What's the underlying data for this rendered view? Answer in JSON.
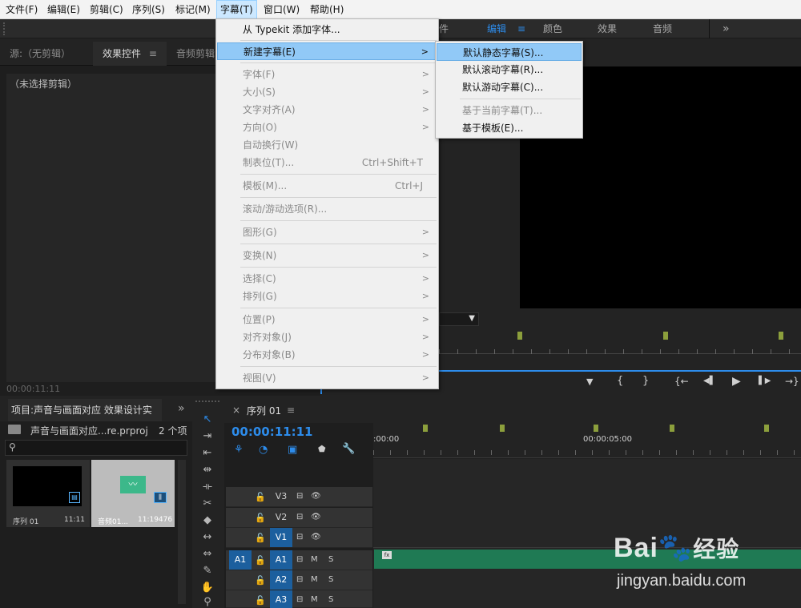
{
  "menubar": {
    "items": [
      "文件(F)",
      "编辑(E)",
      "剪辑(C)",
      "序列(S)",
      "标记(M)",
      "字幕(T)",
      "窗口(W)",
      "帮助(H)"
    ]
  },
  "workspace": {
    "partial": "件",
    "edit": "编辑",
    "menu_glyph": "≡",
    "color": "颜色",
    "effects": "效果",
    "audio": "音频",
    "more": "»"
  },
  "source_panel": {
    "tab_source": "源:（无剪辑）",
    "tab_effects": "效果控件",
    "tab_menu": "≡",
    "tab_audio": "音频剪辑",
    "empty_text": "（未选择剪辑）",
    "timecode": "00:00:11:11"
  },
  "title_menu": {
    "items": [
      {
        "label": "从 Typekit 添加字体...",
        "shortcut": "",
        "arrow": false,
        "disabled": false,
        "highlight": false
      },
      {
        "label": "新建字幕(E)",
        "shortcut": "",
        "arrow": true,
        "disabled": false,
        "highlight": true
      },
      {
        "label": "字体(F)",
        "shortcut": "",
        "arrow": true,
        "disabled": true,
        "highlight": false
      },
      {
        "label": "大小(S)",
        "shortcut": "",
        "arrow": true,
        "disabled": true,
        "highlight": false
      },
      {
        "label": "文字对齐(A)",
        "shortcut": "",
        "arrow": true,
        "disabled": true,
        "highlight": false
      },
      {
        "label": "方向(O)",
        "shortcut": "",
        "arrow": true,
        "disabled": true,
        "highlight": false
      },
      {
        "label": "自动换行(W)",
        "shortcut": "",
        "arrow": false,
        "disabled": true,
        "highlight": false
      },
      {
        "label": "制表位(T)...",
        "shortcut": "Ctrl+Shift+T",
        "arrow": false,
        "disabled": true,
        "highlight": false
      },
      {
        "label": "模板(M)...",
        "shortcut": "Ctrl+J",
        "arrow": false,
        "disabled": true,
        "highlight": false
      },
      {
        "label": "滚动/游动选项(R)...",
        "shortcut": "",
        "arrow": false,
        "disabled": true,
        "highlight": false
      },
      {
        "label": "图形(G)",
        "shortcut": "",
        "arrow": true,
        "disabled": true,
        "highlight": false
      },
      {
        "label": "变换(N)",
        "shortcut": "",
        "arrow": true,
        "disabled": true,
        "highlight": false
      },
      {
        "label": "选择(C)",
        "shortcut": "",
        "arrow": true,
        "disabled": true,
        "highlight": false
      },
      {
        "label": "排列(G)",
        "shortcut": "",
        "arrow": true,
        "disabled": true,
        "highlight": false
      },
      {
        "label": "位置(P)",
        "shortcut": "",
        "arrow": true,
        "disabled": true,
        "highlight": false
      },
      {
        "label": "对齐对象(J)",
        "shortcut": "",
        "arrow": true,
        "disabled": true,
        "highlight": false
      },
      {
        "label": "分布对象(B)",
        "shortcut": "",
        "arrow": true,
        "disabled": true,
        "highlight": false
      },
      {
        "label": "视图(V)",
        "shortcut": "",
        "arrow": true,
        "disabled": true,
        "highlight": false
      }
    ]
  },
  "submenu": {
    "items": [
      {
        "label": "默认静态字幕(S)...",
        "disabled": false,
        "highlight": true
      },
      {
        "label": "默认滚动字幕(R)...",
        "disabled": false,
        "highlight": false
      },
      {
        "label": "默认游动字幕(C)...",
        "disabled": false,
        "highlight": false
      },
      {
        "label": "基于当前字幕(T)...",
        "disabled": true,
        "highlight": false
      },
      {
        "label": "基于模板(E)...",
        "disabled": false,
        "highlight": false
      }
    ]
  },
  "program": {
    "controls": [
      "▼",
      "{",
      "}",
      "{←",
      "◀▌",
      "▶",
      "▌▶",
      "→}"
    ]
  },
  "project_panel": {
    "title": "项目:声音与画面对应 效果设计实",
    "more": "»",
    "file": "声音与画面对应...re.prproj",
    "count": "2 个项",
    "search_placeholder": "",
    "items": [
      {
        "name": "序列 01",
        "duration": "11:11"
      },
      {
        "name": "音频01...",
        "duration": "11:19476"
      }
    ]
  },
  "timeline": {
    "close": "×",
    "tab": "序列 01",
    "menu": "≡",
    "timecode": "00:00:11:11",
    "ruler": [
      ":00:00",
      "00:00:05:00"
    ],
    "tracks": [
      {
        "src": "",
        "name": "V3",
        "type": "video"
      },
      {
        "src": "",
        "name": "V2",
        "type": "video"
      },
      {
        "src": "",
        "name": "V1",
        "type": "video"
      },
      {
        "src": "A1",
        "name": "A1",
        "type": "audio"
      },
      {
        "src": "",
        "name": "A2",
        "type": "audio"
      },
      {
        "src": "",
        "name": "A3",
        "type": "audio"
      }
    ],
    "m_label": "M",
    "s_label": "S",
    "fx": "fx"
  },
  "watermark": {
    "brand": "Bai",
    "brand2": "经验",
    "url": "jingyan.baidu.com"
  }
}
